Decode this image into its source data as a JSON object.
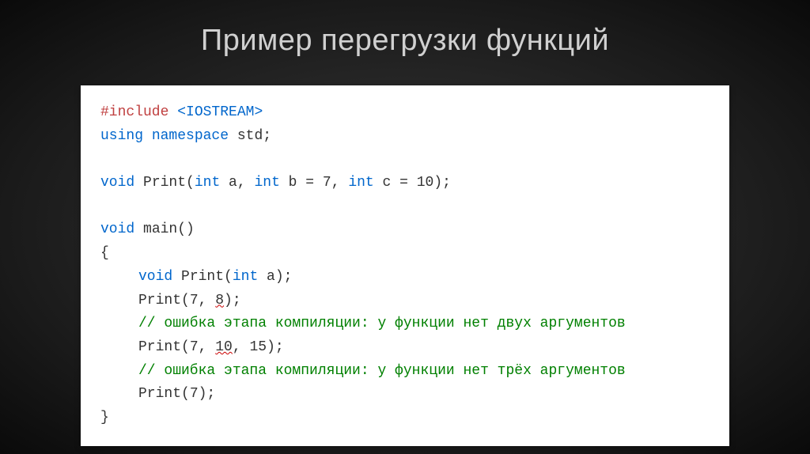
{
  "slide": {
    "title": "Пример перегрузки функций"
  },
  "code": {
    "include_directive": "#include",
    "include_header": " <IOSTREAM>",
    "using_kw": "using",
    "namespace_kw": " namespace ",
    "std_name": "std",
    "semi": ";",
    "void_kw": "void",
    "print_name": " Print",
    "decl_params_open": "(",
    "int_kw": "int",
    "decl_a": " a, ",
    "decl_b": " b = ",
    "decl_b_val": "7",
    "decl_b_comma": ", ",
    "decl_c": " c = ",
    "decl_c_val": "10",
    "decl_close": ")",
    "main_name": " main",
    "main_parens": "()",
    "brace_open": "{",
    "inner_decl_a": " a",
    "call1_pre": "Print(",
    "call1_arg1": "7",
    "call1_comma": ", ",
    "call1_arg2": "8",
    "call1_post": ");",
    "comment_prefix": "// ",
    "comment1": "ошибка этапа компиляции: у функции нет двух аргументов",
    "call2_pre": "Print(",
    "call2_arg1": "7",
    "call2_c1": ", ",
    "call2_arg2": "10",
    "call2_c2": ", ",
    "call2_arg3": "15",
    "call2_post": ");",
    "comment2": "ошибка этапа компиляции: у функции нет трёх аргументов",
    "call3_pre": "Print(",
    "call3_arg": "7",
    "call3_post": ");",
    "brace_close": "}"
  }
}
